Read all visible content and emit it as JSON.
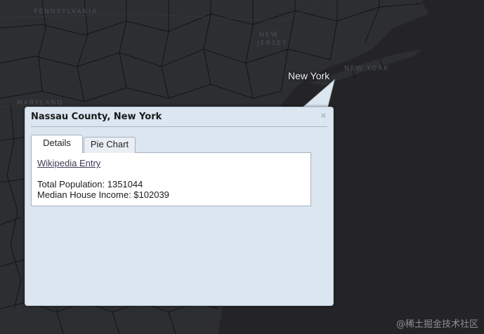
{
  "map": {
    "city_label": "New York",
    "region_labels": {
      "pennsylvania": "PENNSYLVANIA",
      "new_jersey_line1": "NEW",
      "new_jersey_line2": "JERSEY",
      "new_york_right": "NEW YORK",
      "maryland": "MARYLAND"
    },
    "colors": {
      "background": "#262628",
      "land": "#2b2d31",
      "county_border": "#111114",
      "popup_background": "#dbe6f1"
    }
  },
  "popup": {
    "title": "Nassau County, New York",
    "close_label": "×",
    "tabs": [
      {
        "label": "Details",
        "active": true
      },
      {
        "label": "Pie Chart",
        "active": false
      }
    ],
    "details": {
      "link_text": "Wikipedia Entry",
      "total_population": "Total Population: 1351044",
      "median_income": "Median House Income: $102039"
    }
  },
  "watermark": "@稀土掘金技术社区"
}
